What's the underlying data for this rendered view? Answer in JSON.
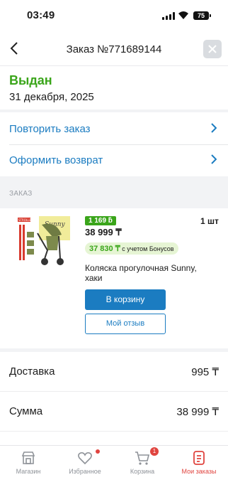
{
  "status_bar": {
    "time": "03:49",
    "battery": "75"
  },
  "header": {
    "title": "Заказ №771689144"
  },
  "order_status": {
    "title": "Выдан",
    "date": "31 декабря, 2025"
  },
  "actions": [
    {
      "label": "Повторить заказ"
    },
    {
      "label": "Оформить возврат"
    }
  ],
  "section": {
    "label": "ЗАКАЗ"
  },
  "product": {
    "bonus": "1 169 ƃ",
    "qty": "1 шт",
    "price": "38 999 ₸",
    "bonus_price": "37 830 ₸",
    "bonus_note": "с учетом Бонусов",
    "name": "Коляска прогулочная Sunny, хаки",
    "image_text": "Sunny",
    "brand_tag": "STROLLER",
    "cart_button": "В корзину",
    "review_button": "Мой отзыв"
  },
  "summary": [
    {
      "label": "Доставка",
      "value": "995 ₸"
    },
    {
      "label": "Сумма",
      "value": "38 999 ₸"
    }
  ],
  "nav": {
    "items": [
      {
        "label": "Магазин"
      },
      {
        "label": "Избранное"
      },
      {
        "label": "Корзина",
        "badge": "1"
      },
      {
        "label": "Мои заказы"
      }
    ]
  },
  "colors": {
    "accent_blue": "#1b7cc1",
    "status_green": "#3aa51a",
    "active_red": "#e0443f"
  }
}
